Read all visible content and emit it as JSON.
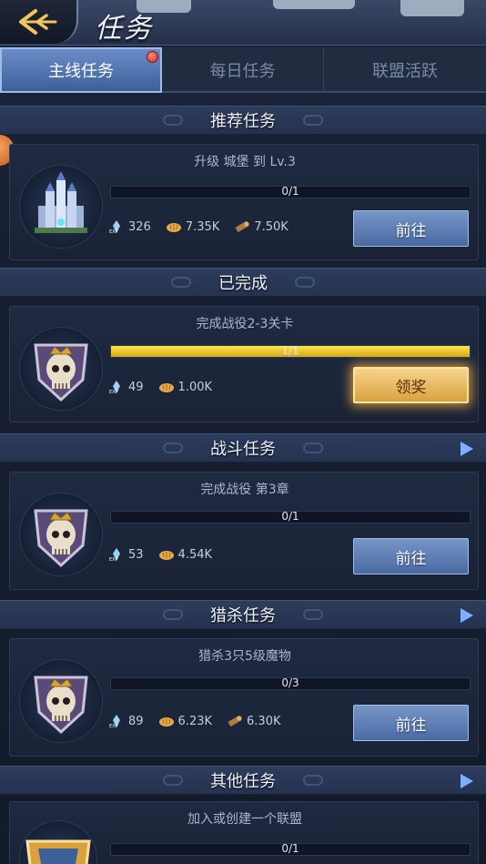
{
  "header": {
    "title": "任务",
    "back_icon": "back-arrow-icon"
  },
  "tabs": [
    {
      "label": "主线任务",
      "active": true,
      "has_notification": true
    },
    {
      "label": "每日任务",
      "active": false
    },
    {
      "label": "联盟活跃",
      "active": false
    }
  ],
  "sections": {
    "recommended": {
      "label": "推荐任务"
    },
    "completed": {
      "label": "已完成"
    },
    "battle": {
      "label": "战斗任务"
    },
    "hunt": {
      "label": "猎杀任务"
    },
    "other": {
      "label": "其他任务"
    }
  },
  "quests": {
    "recommended": {
      "title": "升级 城堡 到 Lv.3",
      "progress_text": "0/1",
      "progress": 0,
      "exp": "326",
      "food": "7.35K",
      "wood": "7.50K",
      "button": "前往",
      "icon": "castle-icon"
    },
    "completed": {
      "title": "完成战役2-3关卡",
      "progress_text": "1/1",
      "progress": 1,
      "exp": "49",
      "food": "1.00K",
      "button": "领奖",
      "icon": "skull-crest-icon"
    },
    "battle": {
      "title": "完成战役 第3章",
      "progress_text": "0/1",
      "progress": 0,
      "exp": "53",
      "food": "4.54K",
      "button": "前往",
      "icon": "skull-crest-icon"
    },
    "hunt": {
      "title": "猎杀3只5级魔物",
      "progress_text": "0/3",
      "progress": 0,
      "exp": "89",
      "food": "6.23K",
      "wood": "6.30K",
      "button": "前往",
      "icon": "skull-crest-icon"
    },
    "other": {
      "title": "加入或创建一个联盟",
      "progress_text": "0/1",
      "progress": 0,
      "icon": "alliance-crest-icon"
    }
  },
  "colors": {
    "accent_blue": "#4a6aa3",
    "progress_gold": "#ffe64a",
    "claim_gold": "#d9a23f",
    "notification_red": "#d22b20"
  }
}
